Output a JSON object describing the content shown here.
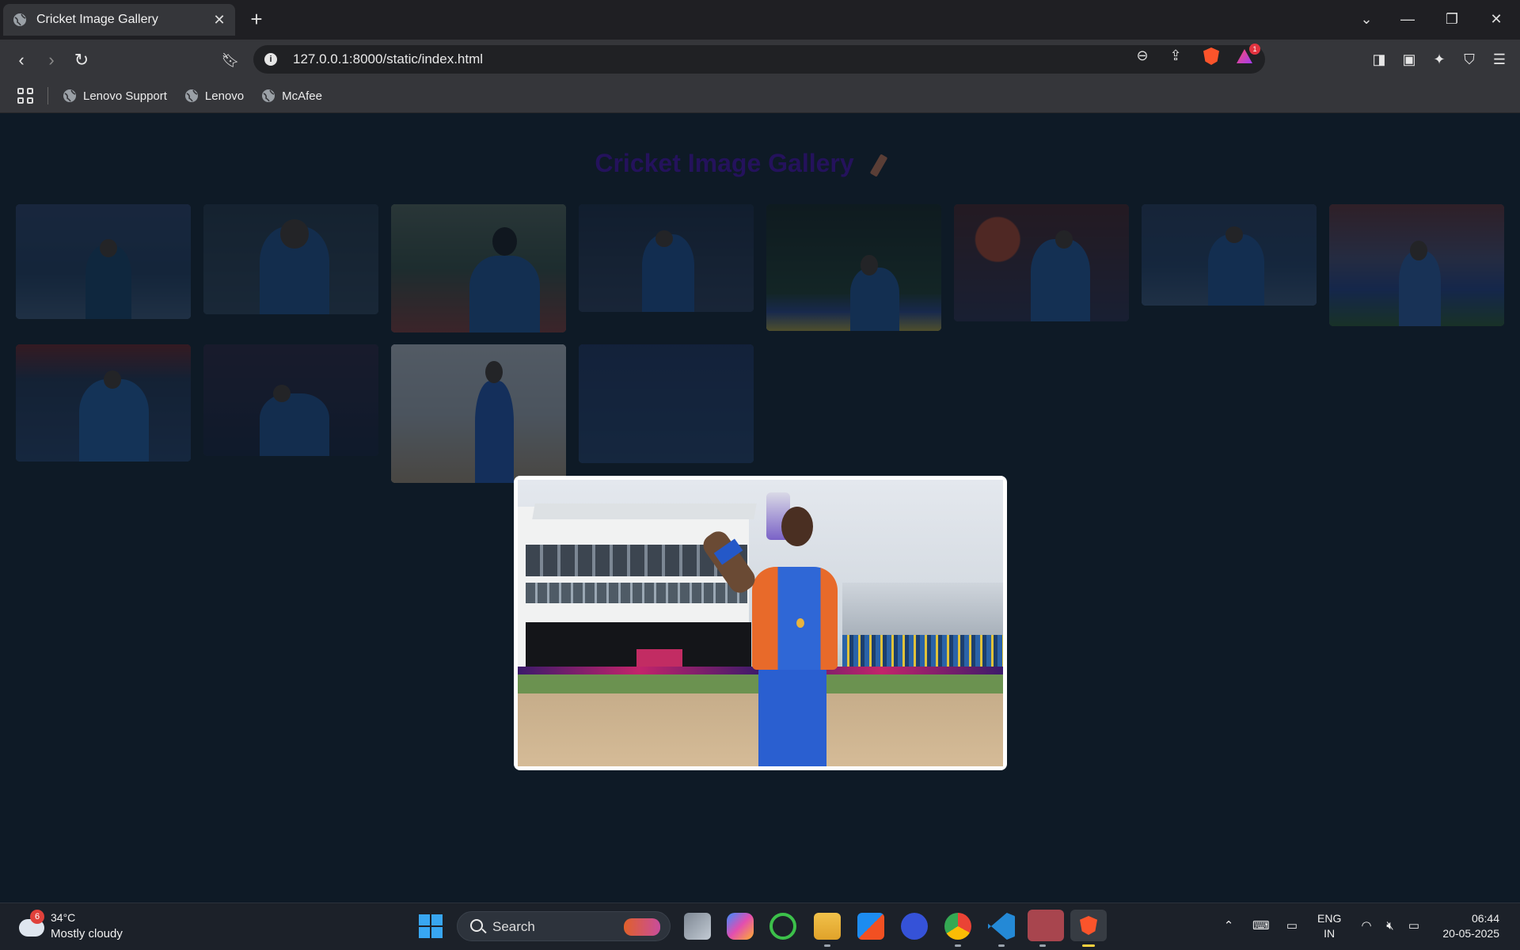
{
  "browser": {
    "tab_title": "Cricket Image Gallery",
    "url": "127.0.0.1:8000/static/index.html",
    "rewards_count": "1",
    "bookmarks": [
      {
        "label": "Lenovo Support"
      },
      {
        "label": "Lenovo"
      },
      {
        "label": "McAfee"
      }
    ]
  },
  "page": {
    "title": "Cricket Image Gallery",
    "thumbnails": [
      {
        "label": "cricket photo 1"
      },
      {
        "label": "cricket photo 2"
      },
      {
        "label": "cricket photo 3"
      },
      {
        "label": "cricket photo 4"
      },
      {
        "label": "cricket photo 5"
      },
      {
        "label": "cricket photo 6"
      },
      {
        "label": "cricket photo 7"
      },
      {
        "label": "cricket photo 8"
      },
      {
        "label": "cricket photo 9"
      },
      {
        "label": "cricket photo 10"
      },
      {
        "label": "cricket photo 11"
      },
      {
        "label": "cricket photo 12"
      }
    ]
  },
  "taskbar": {
    "weather_badge": "6",
    "weather_temp": "34°C",
    "weather_desc": "Mostly cloudy",
    "search_label": "Search",
    "lang_top": "ENG",
    "lang_bottom": "IN",
    "time": "06:44",
    "date": "20-05-2025"
  },
  "colors": {
    "page_bg": "#0e1a26",
    "title": "#24125c",
    "modal_bg": "#ffffff",
    "taskbar": "#1c2129"
  }
}
